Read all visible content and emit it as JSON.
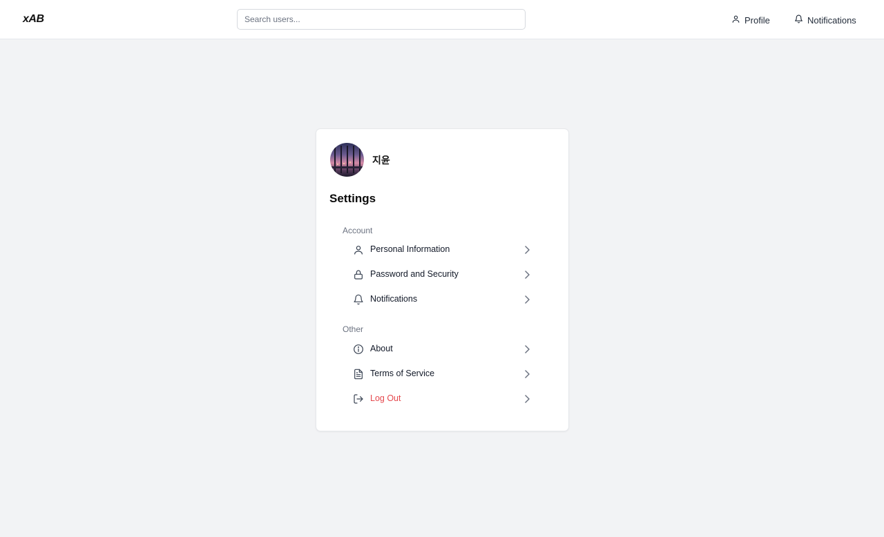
{
  "header": {
    "logo": "xAB",
    "search_placeholder": "Search users...",
    "nav": {
      "profile": "Profile",
      "notifications": "Notifications"
    }
  },
  "profile": {
    "name": "지윤",
    "avatar_icon": "avatar-photo"
  },
  "settings": {
    "title": "Settings",
    "sections": [
      {
        "label": "Account",
        "items": [
          {
            "label": "Personal Information",
            "icon": "user-icon"
          },
          {
            "label": "Password and Security",
            "icon": "lock-icon"
          },
          {
            "label": "Notifications",
            "icon": "bell-icon"
          }
        ]
      },
      {
        "label": "Other",
        "items": [
          {
            "label": "About",
            "icon": "info-icon"
          },
          {
            "label": "Terms of Service",
            "icon": "document-icon"
          },
          {
            "label": "Log Out",
            "icon": "logout-icon",
            "color": "#e5484d"
          }
        ]
      }
    ]
  },
  "colors": {
    "background": "#f2f3f5",
    "danger": "#e5484d",
    "muted": "#6b7280"
  }
}
